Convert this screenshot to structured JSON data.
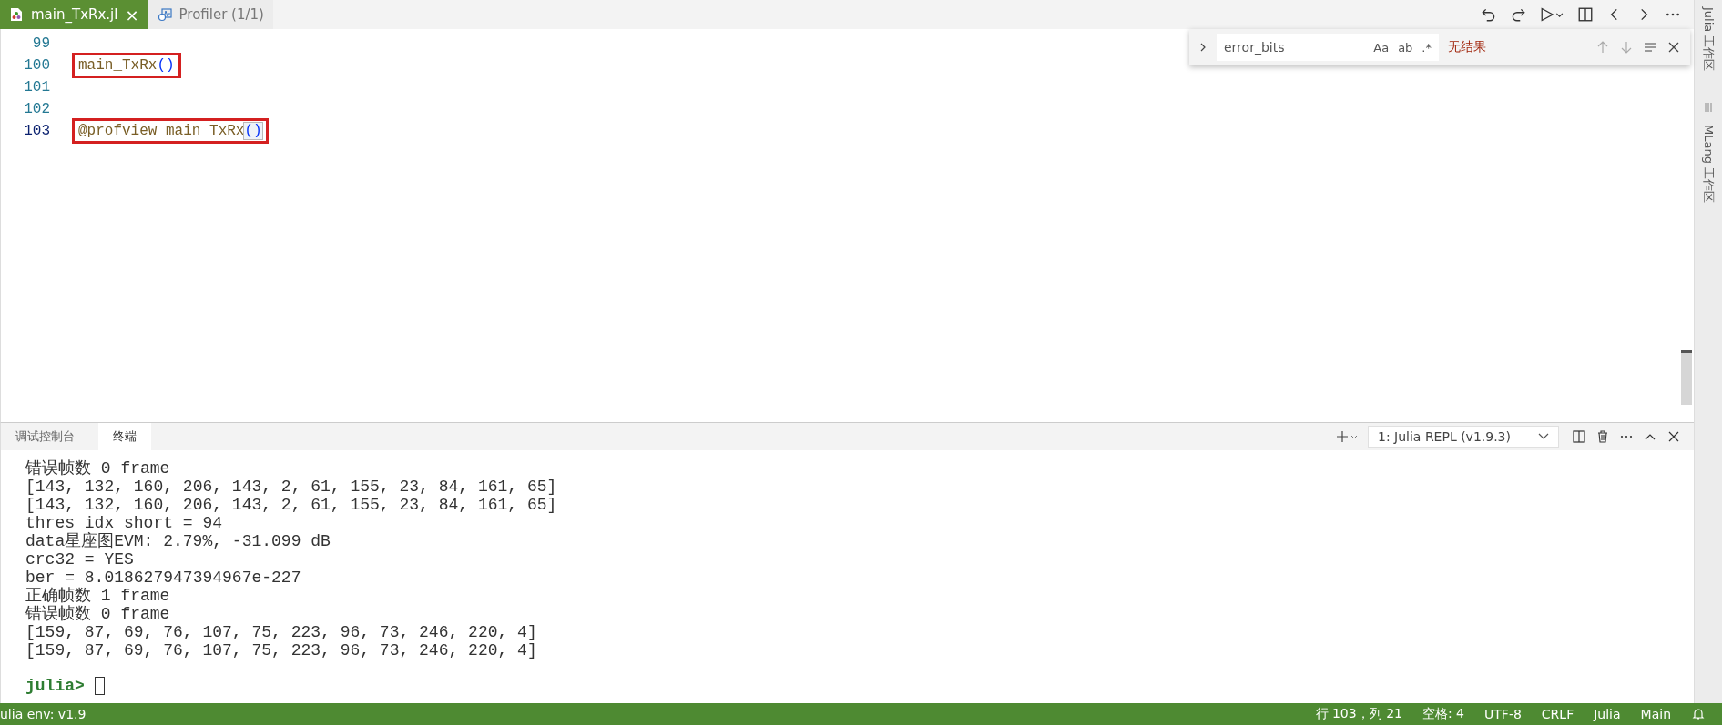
{
  "editor_tabs": [
    {
      "label": "main_TxRx.jl",
      "selected": true,
      "close": "×"
    },
    {
      "label": "Profiler (1/1)",
      "selected": false
    }
  ],
  "code_lines": [
    {
      "number": "99",
      "active": false
    },
    {
      "number": "100",
      "active": false,
      "boxed": true,
      "segments": [
        {
          "text": "main_TxRx",
          "kind": "func"
        },
        {
          "text": "()",
          "kind": "paren"
        }
      ]
    },
    {
      "number": "101",
      "active": false
    },
    {
      "number": "102",
      "active": false
    },
    {
      "number": "103",
      "active": true,
      "boxed": true,
      "segments": [
        {
          "text": "@profview main_TxRx",
          "kind": "func"
        },
        {
          "text": "()",
          "kind": "paren-match"
        }
      ]
    }
  ],
  "find_widget": {
    "value": "error_bits",
    "options": [
      {
        "label": "Aa",
        "selected": false
      },
      {
        "label": "ab",
        "selected": false
      },
      {
        "label": ".*",
        "selected": false
      }
    ],
    "result": "无结果"
  },
  "side_bar": [
    {
      "label": "Julia 工作区",
      "kind": "text"
    },
    {
      "kind": "grip"
    },
    {
      "label": "MLang 工作区",
      "kind": "text"
    }
  ],
  "panel_tabs": [
    {
      "label": "调试控制台",
      "selected": false
    },
    {
      "label": "终端",
      "selected": true
    }
  ],
  "terminal_select": "1: Julia REPL (v1.9.3)",
  "terminal_lines": [
    "错误帧数 0 frame",
    "[143, 132, 160, 206, 143, 2, 61, 155, 23, 84, 161, 65]",
    "[143, 132, 160, 206, 143, 2, 61, 155, 23, 84, 161, 65]",
    "thres_idx_short = 94",
    "data星座图EVM: 2.79%, -31.099 dB",
    "crc32 = YES",
    "ber = 8.018627947394967e-227",
    "正确帧数 1 frame",
    "错误帧数 0 frame",
    "[159, 87, 69, 76, 107, 75, 223, 96, 73, 246, 220, 4]",
    "[159, 87, 69, 76, 107, 75, 223, 96, 73, 246, 220, 4]"
  ],
  "prompt": "julia>",
  "status_bar": {
    "left": "ulia env: v1.9",
    "right": [
      "行 103，列 21",
      "空格: 4",
      "UTF-8",
      "CRLF",
      "Julia",
      "Main"
    ]
  }
}
